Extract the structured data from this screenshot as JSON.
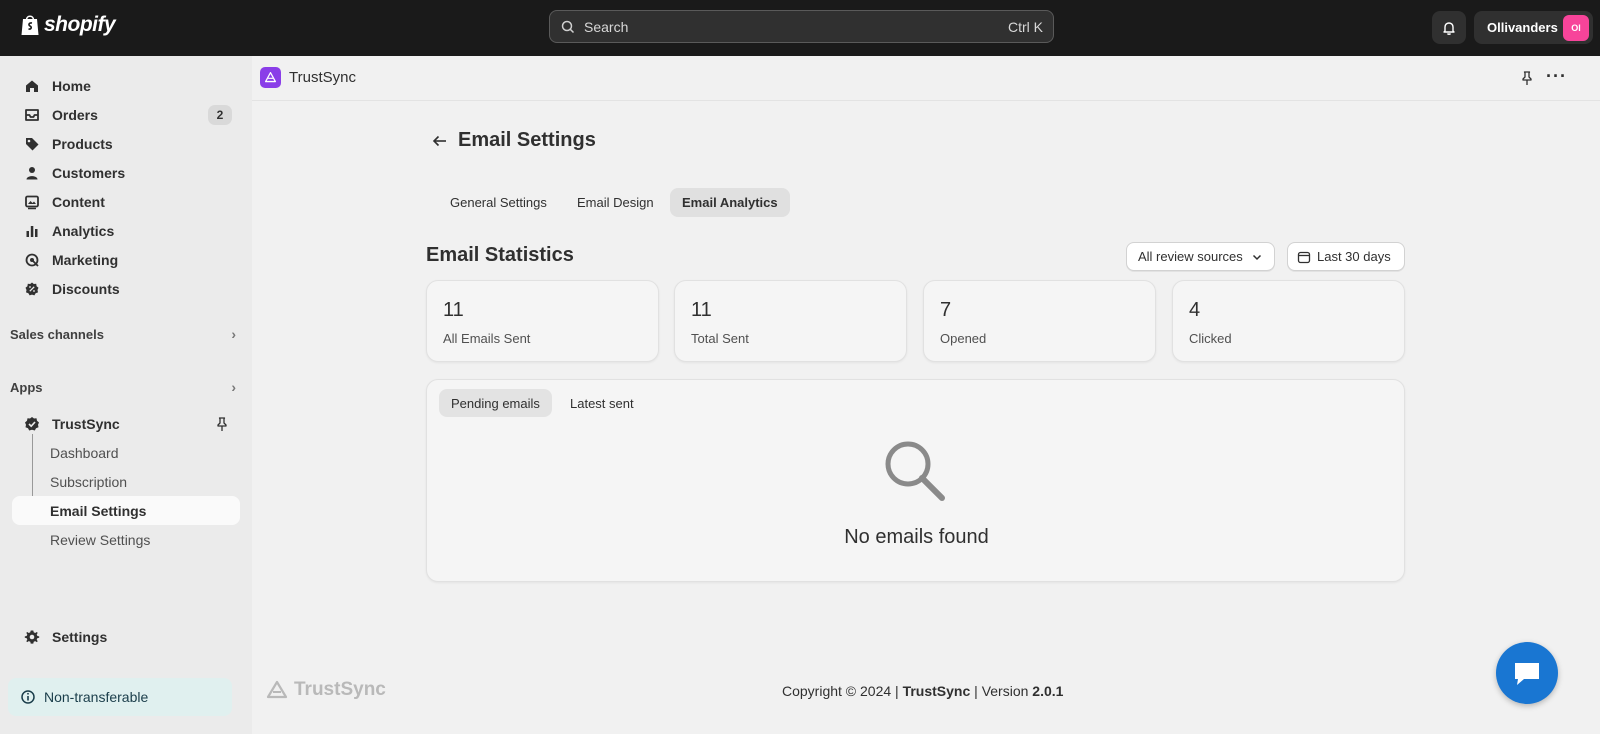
{
  "topbar": {
    "brand": "shopify",
    "search_placeholder": "Search",
    "search_shortcut": "Ctrl K",
    "account_name": "Ollivanders",
    "account_initials": "Ol"
  },
  "sidebar": {
    "nav": [
      {
        "label": "Home",
        "icon": "home-icon"
      },
      {
        "label": "Orders",
        "icon": "orders-icon",
        "badge": "2"
      },
      {
        "label": "Products",
        "icon": "tag-icon"
      },
      {
        "label": "Customers",
        "icon": "person-icon"
      },
      {
        "label": "Content",
        "icon": "content-icon"
      },
      {
        "label": "Analytics",
        "icon": "bar-chart-icon"
      },
      {
        "label": "Marketing",
        "icon": "target-icon"
      },
      {
        "label": "Discounts",
        "icon": "discount-icon"
      }
    ],
    "sales_channels": "Sales channels",
    "apps": "Apps",
    "app_name": "TrustSync",
    "app_subnav": [
      "Dashboard",
      "Subscription",
      "Email Settings",
      "Review Settings"
    ],
    "settings": "Settings",
    "non_transferable": "Non-transferable"
  },
  "app_header": {
    "title": "TrustSync"
  },
  "page": {
    "title": "Email Settings",
    "tabs": [
      "General Settings",
      "Email Design",
      "Email Analytics"
    ],
    "active_tab": "Email Analytics",
    "stats_title": "Email Statistics",
    "source_filter": "All review sources",
    "date_filter": "Last 30 days",
    "stats": [
      {
        "value": "11",
        "label": "All Emails Sent"
      },
      {
        "value": "11",
        "label": "Total Sent"
      },
      {
        "value": "7",
        "label": "Opened"
      },
      {
        "value": "4",
        "label": "Clicked"
      }
    ],
    "list_tabs": [
      "Pending emails",
      "Latest sent"
    ],
    "empty_message": "No emails found"
  },
  "footer": {
    "logo_text": "TrustSync",
    "copyright_prefix": "Copyright © 2024 |",
    "brand": "TrustSync",
    "version_label": "| Version",
    "version": "2.0.1"
  },
  "colors": {
    "topbar": "#1a1a1a",
    "sidebar": "#ebebeb",
    "app_accent": "#8a3ee8",
    "avatar": "#f7449a",
    "chat": "#1976d2"
  }
}
